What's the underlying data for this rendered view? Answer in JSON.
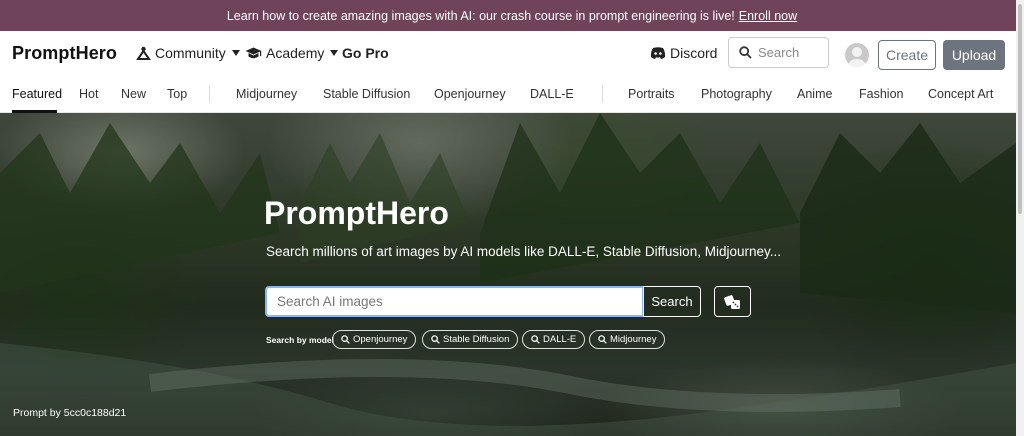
{
  "banner": {
    "text": "Learn how to create amazing images with AI: our crash course in prompt engineering is live!",
    "link": "Enroll now"
  },
  "nav": {
    "brand": "PromptHero",
    "community": "Community",
    "academy": "Academy",
    "gopro": "Go Pro",
    "discord": "Discord",
    "search_placeholder": "Search",
    "create": "Create",
    "upload": "Upload"
  },
  "tabs": {
    "featured": "Featured",
    "hot": "Hot",
    "new": "New",
    "top": "Top",
    "midjourney": "Midjourney",
    "stable_diffusion": "Stable Diffusion",
    "openjourney": "Openjourney",
    "dalle": "DALL-E",
    "portraits": "Portraits",
    "photography": "Photography",
    "anime": "Anime",
    "fashion": "Fashion",
    "concept_art": "Concept Art"
  },
  "hero": {
    "title": "PromptHero",
    "subtitle": "Search millions of art images by AI models like DALL-E, Stable Diffusion, Midjourney...",
    "input_placeholder": "Search AI images",
    "search_button": "Search",
    "model_label": "Search by model",
    "models": [
      "Openjourney",
      "Stable Diffusion",
      "DALL-E",
      "Midjourney"
    ],
    "credit": "Prompt by 5cc0c188d21"
  },
  "colors": {
    "banner_bg": "#6f4359",
    "upload_bg": "#6c757d",
    "input_focus_border": "#86b7fe"
  },
  "icons": [
    "community-icon",
    "academy-icon",
    "discord-icon",
    "search-icon",
    "avatar-icon",
    "dice-icon",
    "chip-search-icon"
  ]
}
